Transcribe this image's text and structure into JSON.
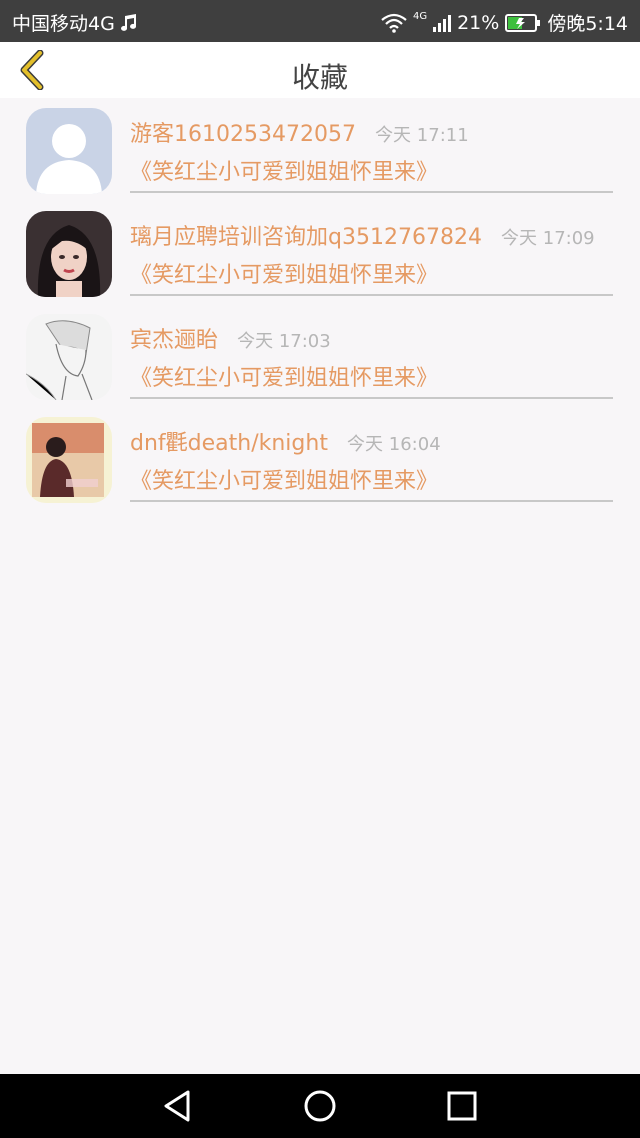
{
  "status_bar": {
    "carrier": "中国移动4G",
    "network": "4G",
    "battery": "21%",
    "time": "傍晚5:14"
  },
  "header": {
    "title": "收藏"
  },
  "favorites": [
    {
      "user": "游客1610253472057",
      "time": "今天 17:11",
      "item": "《笑红尘小可爱到姐姐怀里来》"
    },
    {
      "user": "璃月应聘培训咨询加q3512767824",
      "time": "今天 17:09",
      "item": "《笑红尘小可爱到姐姐怀里来》"
    },
    {
      "user": "宾杰逦眙",
      "time": "今天 17:03",
      "item": "《笑红尘小可爱到姐姐怀里来》"
    },
    {
      "user": "dnf氍death/knight",
      "time": "今天 16:04",
      "item": "《笑红尘小可爱到姐姐怀里来》"
    }
  ],
  "colors": {
    "accent": "#e59a63",
    "back_arrow": "#e3bf2a",
    "muted": "#b6b6b6"
  }
}
